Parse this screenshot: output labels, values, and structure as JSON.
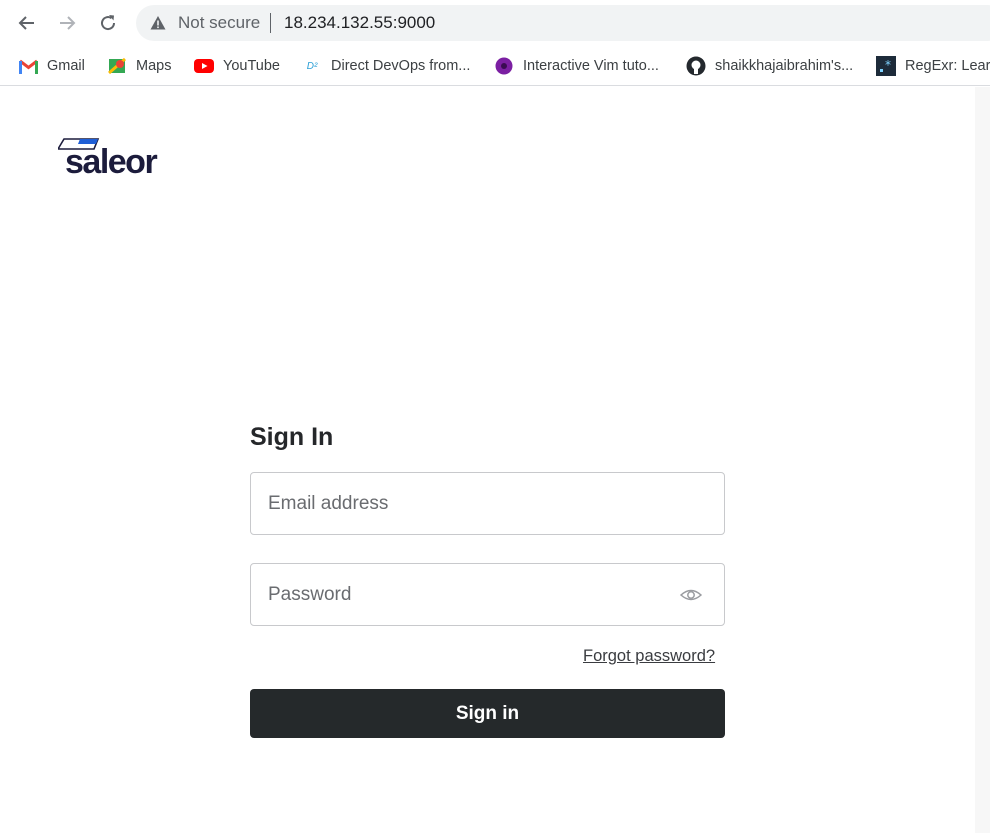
{
  "browser": {
    "security_label": "Not secure",
    "url": "18.234.132.55:9000",
    "bookmarks": [
      {
        "label": "Gmail",
        "icon": "gmail-icon"
      },
      {
        "label": "Maps",
        "icon": "maps-icon"
      },
      {
        "label": "YouTube",
        "icon": "youtube-icon"
      },
      {
        "label": "Direct DevOps from...",
        "icon": "devops-icon"
      },
      {
        "label": "Interactive Vim tuto...",
        "icon": "vim-icon"
      },
      {
        "label": "shaikkhajaibrahim's...",
        "icon": "github-icon"
      },
      {
        "label": "RegExr: Learn",
        "icon": "regexr-icon"
      }
    ]
  },
  "brand": {
    "name": "saleor",
    "color": "#1c1c3c",
    "accent": "#1f5fd6"
  },
  "signin": {
    "title": "Sign In",
    "email_placeholder": "Email address",
    "email_value": "",
    "password_placeholder": "Password",
    "password_value": "",
    "forgot_label": "Forgot password?",
    "submit_label": "Sign in"
  },
  "colors": {
    "button_bg": "#25292b",
    "button_text": "#ffffff",
    "border": "#c8c9cc"
  }
}
